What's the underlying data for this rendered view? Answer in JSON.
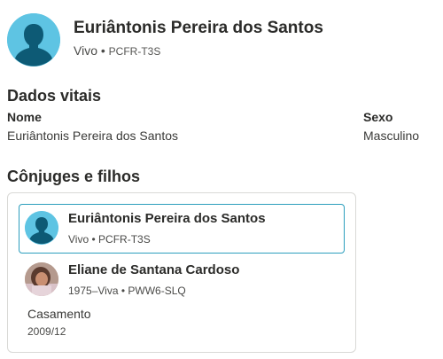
{
  "header": {
    "name": "Euriântonis Pereira dos Santos",
    "status": "Vivo",
    "separator": "•",
    "pid": "PCFR-T3S",
    "avatar_icon": "male-silhouette-icon"
  },
  "vitals": {
    "title": "Dados vitais",
    "name_label": "Nome",
    "name_value": "Euriântonis Pereira dos Santos",
    "sex_label": "Sexo",
    "sex_value": "Masculino"
  },
  "family": {
    "title": "Cônjuges e filhos",
    "persons": [
      {
        "name": "Euriântonis Pereira dos Santos",
        "status": "Vivo",
        "pid": "PCFR-T3S",
        "avatar_icon": "male-silhouette-icon"
      },
      {
        "name": "Eliane de Santana Cardoso",
        "status": "1975–Viva",
        "pid": "PWW6-SLQ",
        "avatar_icon": "photo-avatar"
      }
    ],
    "marriage_label": "Casamento",
    "marriage_date": "2009/12"
  },
  "colors": {
    "accent": "#2c9ebd",
    "avatar_bg": "#5ec4e3",
    "avatar_figure": "#0d5a75"
  }
}
